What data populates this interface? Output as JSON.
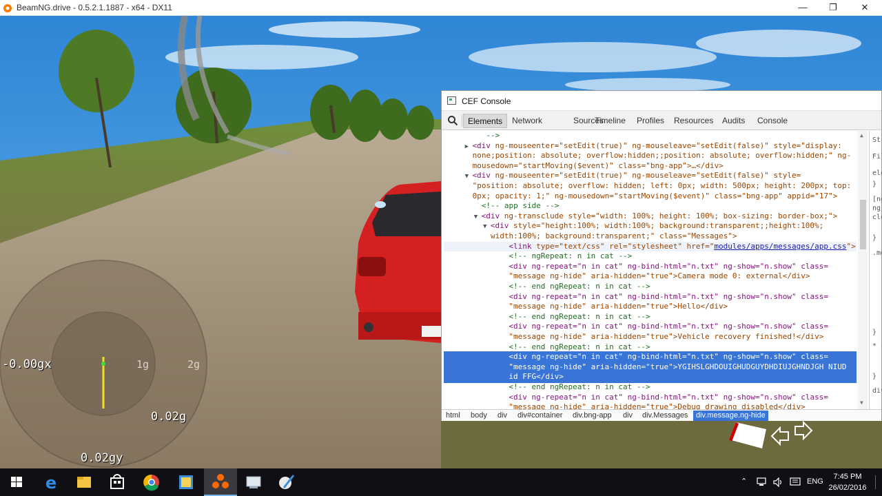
{
  "window": {
    "title": "BeamNG.drive - 0.5.2.1.1887 - x64 - DX11",
    "minimize_glyph": "—",
    "maximize_glyph": "❐",
    "close_glyph": "✕"
  },
  "hud": {
    "gforce_x": "-0.00gx",
    "gforce_y": "0.02gy",
    "ring_label_1g": "1g",
    "ring_label_2g": "2g",
    "total_g": "0.02g"
  },
  "console": {
    "title": "CEF Console",
    "tabs": [
      "Elements",
      "Network",
      "Sources",
      "Timeline",
      "Profiles",
      "Resources",
      "Audits",
      "Console"
    ],
    "selected_tab": "Elements",
    "dom_lines": [
      {
        "indent": 9,
        "text": "-->",
        "kind": "comment"
      },
      {
        "indent": 6,
        "tri": "▶",
        "tag": "<div",
        "attrs": " ng-mouseenter=\"setEdit(true)\" ng-mouseleave=\"setEdit(false)\" style=\"display:",
        "kind": "tagline"
      },
      {
        "indent": 6,
        "text": "none;position: absolute; overflow:hidden;;position: absolute; overflow:hidden;\" ng-",
        "kind": "attrval"
      },
      {
        "indent": 6,
        "text": "mousedown=\"startMoving($event)\" class=\"bng-app\">…</div>",
        "kind": "attrval"
      },
      {
        "indent": 6,
        "tri": "▼",
        "tag": "<div",
        "attrs": " ng-mouseenter=\"setEdit(true)\" ng-mouseleave=\"setEdit(false)\" style=",
        "kind": "tagline"
      },
      {
        "indent": 6,
        "text": "\"position: absolute; overflow: hidden; left: 0px; width: 500px; height: 200px; top:",
        "kind": "attrval"
      },
      {
        "indent": 6,
        "text": "0px; opacity: 1;\" ng-mousedown=\"startMoving($event)\" class=\"bng-app\" appid=\"17\">",
        "kind": "attrval"
      },
      {
        "indent": 8,
        "text": "<!-- app side -->",
        "kind": "comment"
      },
      {
        "indent": 8,
        "tri": "▼",
        "tag": "<div",
        "attrs": " ng-transclude style=\"width: 100%; height: 100%; box-sizing: border-box;\">",
        "kind": "tagline"
      },
      {
        "indent": 10,
        "tri": "▼",
        "tag": "<div",
        "attrs": " style=\"height:100%; width:100%; background:transparent;;height:100%;",
        "kind": "tagline"
      },
      {
        "indent": 10,
        "text": "width:100%; background:transparent;\" class=\"Messages\">",
        "kind": "attrval"
      },
      {
        "indent": 14,
        "tag": "<link",
        "attrs": " type=\"text/css\" rel=\"stylesheet\" href=\"",
        "link": "modules/apps/messages/app.css",
        "after": "\">",
        "kind": "link"
      },
      {
        "indent": 14,
        "text": "<!-- ngRepeat: n in cat -->",
        "kind": "comment"
      },
      {
        "indent": 14,
        "text": "<div ng-repeat=\"n in cat\" ng-bind-html=\"n.txt\" ng-show=\"n.show\" class=",
        "kind": "tagline2"
      },
      {
        "indent": 14,
        "text": "\"message ng-hide\" aria-hidden=\"true\">Camera mode 0: external</div>",
        "kind": "attrval"
      },
      {
        "indent": 14,
        "text": "<!-- end ngRepeat: n in cat -->",
        "kind": "comment"
      },
      {
        "indent": 14,
        "text": "<div ng-repeat=\"n in cat\" ng-bind-html=\"n.txt\" ng-show=\"n.show\" class=",
        "kind": "tagline2"
      },
      {
        "indent": 14,
        "text": "\"message ng-hide\" aria-hidden=\"true\">Hello</div>",
        "kind": "attrval"
      },
      {
        "indent": 14,
        "text": "<!-- end ngRepeat: n in cat -->",
        "kind": "comment"
      },
      {
        "indent": 14,
        "text": "<div ng-repeat=\"n in cat\" ng-bind-html=\"n.txt\" ng-show=\"n.show\" class=",
        "kind": "tagline2"
      },
      {
        "indent": 14,
        "text": "\"message ng-hide\" aria-hidden=\"true\">Vehicle recovery finished!</div>",
        "kind": "attrval"
      },
      {
        "indent": 14,
        "text": "<!-- end ngRepeat: n in cat -->",
        "kind": "comment"
      },
      {
        "indent": 14,
        "text": "<div ng-repeat=\"n in cat\" ng-bind-html=\"n.txt\" ng-show=\"n.show\" class=",
        "kind": "selected"
      },
      {
        "indent": 14,
        "text": "\"message ng-hide\" aria-hidden=\"true\">YGIHSLGHDOUIGHUDGUYDHDIUJGHNDJGH NIUD",
        "kind": "selected"
      },
      {
        "indent": 14,
        "text": "id FFG</div>",
        "kind": "selected"
      },
      {
        "indent": 14,
        "text": "<!-- end ngRepeat: n in cat -->",
        "kind": "comment"
      },
      {
        "indent": 14,
        "text": "<div ng-repeat=\"n in cat\" ng-bind-html=\"n.txt\" ng-show=\"n.show\" class=",
        "kind": "tagline2"
      },
      {
        "indent": 14,
        "text": "\"message ng-hide\" aria-hidden=\"true\">Debug drawing disabled</div>",
        "kind": "attrval"
      }
    ],
    "styles_side": [
      "St",
      "Filt",
      "ele",
      "}",
      "[ng",
      "ng-",
      "clo",
      "}",
      ".me",
      "}",
      "* {",
      "}",
      "div"
    ],
    "breadcrumbs": [
      "html",
      "body",
      "div",
      "div#container",
      "div.bng-app",
      "div",
      "div.Messages",
      "div.message.ng-hide"
    ],
    "selected_breadcrumb": "div.message.ng-hide"
  },
  "taskbar": {
    "icons": [
      "windows-start",
      "edge",
      "file-explorer",
      "store",
      "chrome",
      "paint-app",
      "beamng",
      "network-tool",
      "brush-app"
    ],
    "active": "beamng",
    "tray": {
      "lang": "ENG",
      "time": "7:45 PM",
      "date": "26/02/2016"
    }
  }
}
